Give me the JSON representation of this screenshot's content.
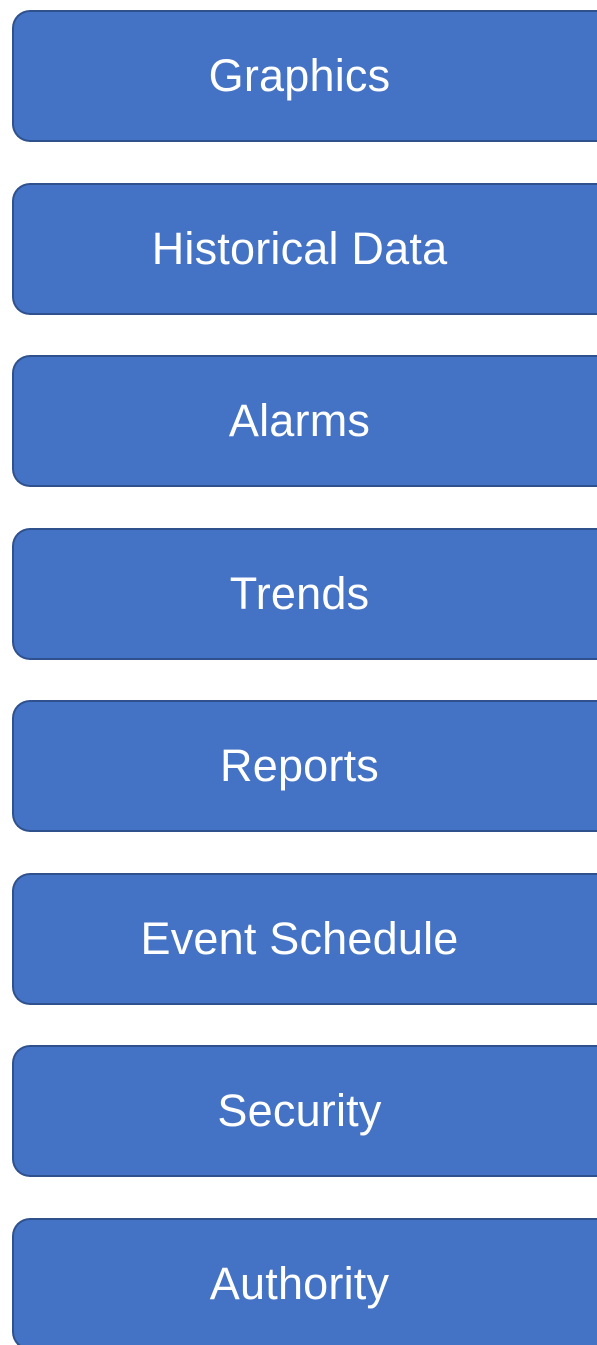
{
  "menu": {
    "items": [
      {
        "label": "Graphics"
      },
      {
        "label": "Historical Data"
      },
      {
        "label": "Alarms"
      },
      {
        "label": "Trends"
      },
      {
        "label": "Reports"
      },
      {
        "label": "Event Schedule"
      },
      {
        "label": "Security"
      },
      {
        "label": "Authority"
      }
    ]
  },
  "colors": {
    "button_fill": "#4472c4",
    "button_border": "#2f528f",
    "label_text": "#ffffff",
    "background": "#ffffff"
  }
}
